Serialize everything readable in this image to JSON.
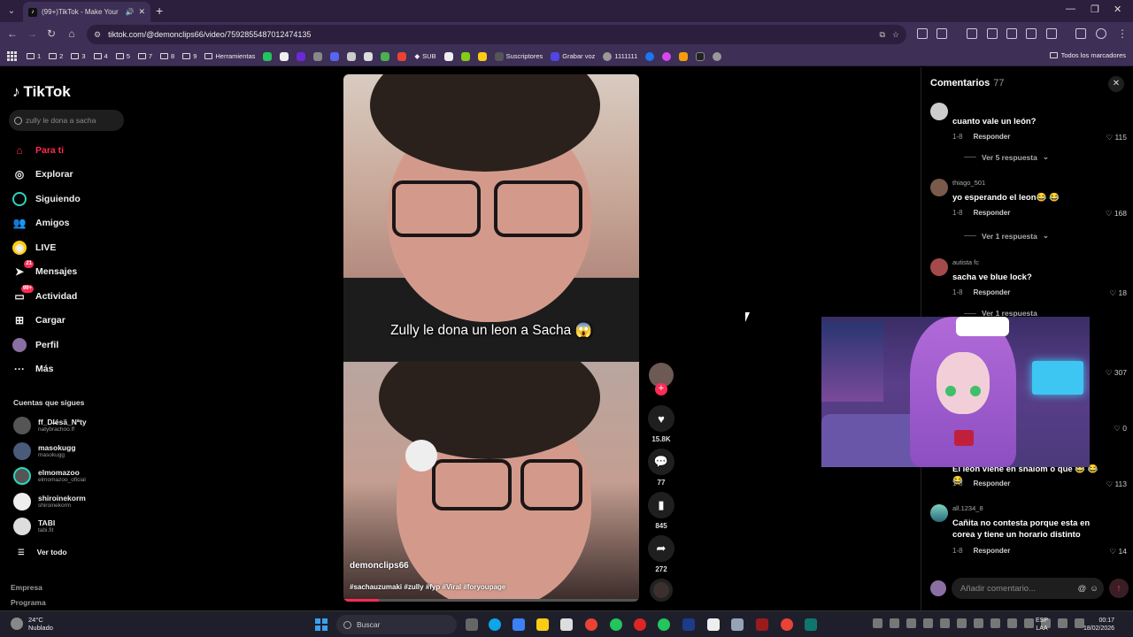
{
  "browser": {
    "tab_title": "(99+)TikTok - Make Your Day",
    "url": "tiktok.com/@demonclips66/video/7592855487012474135",
    "bookmarks": [
      "1",
      "2",
      "3",
      "4",
      "5",
      "7",
      "8",
      "9",
      "Herramientas",
      "SUB",
      "Suscriptores",
      "Grabar voz",
      "1111111"
    ],
    "all_bookmarks": "Todos los marcadores"
  },
  "sidebar": {
    "logo": "TikTok",
    "search_placeholder": "zully le dona a sacha",
    "nav": [
      {
        "label": "Para ti",
        "icon": "home-icon"
      },
      {
        "label": "Explorar",
        "icon": "compass-icon"
      },
      {
        "label": "Siguiendo",
        "icon": "following-icon"
      },
      {
        "label": "Amigos",
        "icon": "friends-icon"
      },
      {
        "label": "LIVE",
        "icon": "live-icon"
      },
      {
        "label": "Mensajes",
        "icon": "messages-icon",
        "badge": "21"
      },
      {
        "label": "Actividad",
        "icon": "activity-icon",
        "badge": "99+"
      },
      {
        "label": "Cargar",
        "icon": "upload-icon"
      },
      {
        "label": "Perfil",
        "icon": "profile-icon"
      },
      {
        "label": "Más",
        "icon": "more-icon"
      }
    ],
    "following_heading": "Cuentas que sigues",
    "following": [
      {
        "name": "ff_Dl̶̶ésä_Nªty",
        "handle": "natybrachoo.ff"
      },
      {
        "name": "masokugg",
        "handle": "masokugg"
      },
      {
        "name": "elmomazoo",
        "handle": "elmomazoo_oficial"
      },
      {
        "name": "shiroinekorm",
        "handle": "shiroinekorm"
      },
      {
        "name": "TABI",
        "handle": "tabi.fit"
      }
    ],
    "see_all": "Ver todo",
    "footer": [
      "Empresa",
      "Programa"
    ]
  },
  "video": {
    "caption": "Zully le dona un leon a Sacha 😱",
    "author": "demonclips66",
    "tags": "#sachauzumaki #zully #fyp #Viral #foryoupage",
    "progress": 0.12
  },
  "actions": {
    "likes": "15.8K",
    "comments": "77",
    "saves": "845",
    "shares": "272"
  },
  "comments_panel": {
    "title": "Comentarios",
    "count": "77",
    "items": [
      {
        "user": "",
        "text": "cuanto vale un león?",
        "date": "1-8",
        "reply": "Responder",
        "likes": "115",
        "replies": "Ver 5 respuesta"
      },
      {
        "user": "thiago_501",
        "text": "yo esperando el leon😂 😂",
        "date": "1-8",
        "reply": "Responder",
        "likes": "168",
        "replies": "Ver 1 respuesta"
      },
      {
        "user": "autista fc",
        "text": "sacha ve blue lock?",
        "date": "1-8",
        "reply": "Responder",
        "likes": "18",
        "replies": "Ver 1 respuesta"
      },
      {
        "user": "",
        "text": "",
        "date": "",
        "reply": "",
        "likes": "307",
        "replies": ""
      },
      {
        "user": "",
        "text": "",
        "date": "",
        "reply": "",
        "likes": "0",
        "replies": ""
      },
      {
        "user": "",
        "text": "El leon viene en shalom o que 😂 😂 😂",
        "date": "1-8",
        "reply": "Responder",
        "likes": "113",
        "replies": ""
      },
      {
        "user": "all.1234_8",
        "text": "Cañita no contesta porque esta en corea y tiene un horario distinto",
        "date": "1-8",
        "reply": "Responder",
        "likes": "14",
        "replies": ""
      }
    ],
    "input_placeholder": "Añadir comentario..."
  },
  "taskbar": {
    "temperature": "24°C",
    "weather": "Nublado",
    "search": "Buscar",
    "lang1": "ESP",
    "lang2": "LAA",
    "time": "00:17",
    "date": "18/02/2026"
  },
  "colors": {
    "accent": "#fe2c55",
    "chrome": "#3d2f55",
    "tabbar": "#2b1f3d"
  }
}
